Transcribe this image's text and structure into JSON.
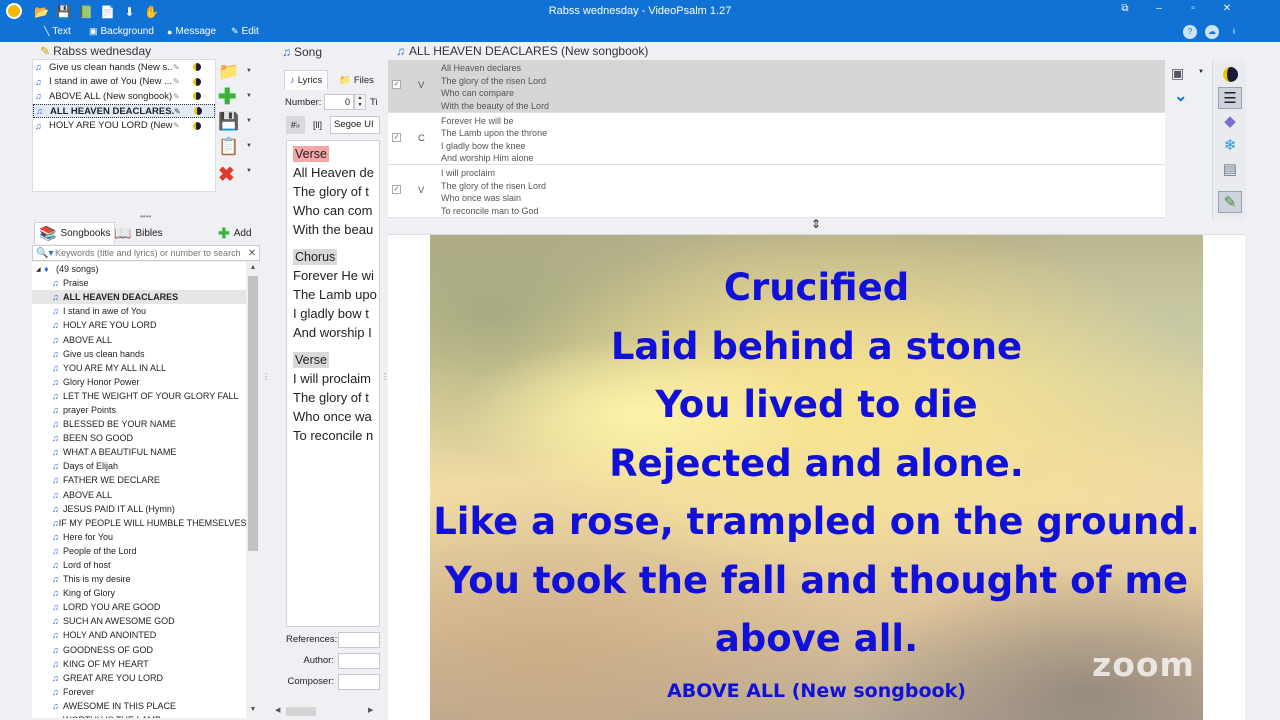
{
  "window": {
    "title": "Rabss wednesday - VideoPsalm 1.27",
    "minimize": "⧉",
    "restore": "–",
    "maximize": "▫",
    "close": "✕"
  },
  "menu": {
    "items": [
      {
        "label": "Text",
        "icon": "text-icon"
      },
      {
        "label": "Background",
        "icon": "background-icon"
      },
      {
        "label": "Message",
        "icon": "message-icon"
      },
      {
        "label": "Edit",
        "icon": "edit-icon"
      }
    ]
  },
  "schedule": {
    "title": "Rabss wednesday",
    "items": [
      {
        "label": "Give us clean hands (New s..."
      },
      {
        "label": "I stand in awe of You (New ..."
      },
      {
        "label": "ABOVE ALL (New songbook)"
      },
      {
        "label": "ALL HEAVEN DEACLARES..."
      },
      {
        "label": "HOLY ARE YOU LORD (New..."
      }
    ],
    "selected_index": 3
  },
  "songbook": {
    "tabs": {
      "songbooks": "Songbooks",
      "bibles": "Bibles",
      "add": "Add"
    },
    "search_placeholder": "Keywords (title and lyrics) or number to search",
    "root_label": "(49 songs)",
    "songs": [
      "Praise",
      "ALL HEAVEN DEACLARES",
      "I stand in awe of You",
      "HOLY ARE YOU LORD",
      "ABOVE ALL",
      "Give us clean hands",
      "YOU ARE MY ALL IN ALL",
      "Glory Honor Power",
      "LET THE WEIGHT OF YOUR GLORY FALL",
      "prayer Points",
      "BLESSED BE YOUR NAME",
      "BEEN SO GOOD",
      "WHAT A BEAUTIFUL NAME",
      "Days of Elijah",
      "FATHER WE DECLARE",
      "ABOVE ALL",
      "JESUS PAID IT ALL (Hymn)",
      "IF MY PEOPLE WILL HUMBLE THEMSELVES",
      "Here for You",
      "People of the Lord",
      "Lord of host",
      "This is my desire",
      "King of Glory",
      "LORD YOU ARE GOOD",
      "SUCH AN AWESOME GOD",
      "HOLY AND ANOINTED",
      "GOODNESS OF GOD",
      "KING OF MY HEART",
      "GREAT ARE YOU LORD",
      "Forever",
      "AWESOME IN THIS PLACE",
      "WORTHY IS THE LAMB"
    ],
    "selected_index": 1
  },
  "song_editor": {
    "title": "Song",
    "tabs": {
      "lyrics": "Lyrics",
      "files": "Files"
    },
    "number_label": "Number:",
    "number_value": "0",
    "title_label_cut": "Ti",
    "font_value": "Segoe UI",
    "blocks": [
      {
        "tag": "Verse",
        "lines": [
          "All Heaven de",
          "The glory of t",
          "Who can com",
          "With the beau"
        ]
      },
      {
        "tag": "Chorus",
        "lines": [
          "Forever He wi",
          "The Lamb upo",
          "I gladly bow t",
          "And worship I"
        ]
      },
      {
        "tag": "Verse",
        "lines": [
          "I will proclaim",
          "The glory of t",
          "Who once wa",
          "To reconcile n"
        ]
      }
    ],
    "references_label": "References:",
    "author_label": "Author:",
    "composer_label": "Composer:"
  },
  "verse_grid": {
    "title": "ALL HEAVEN DEACLARES (New songbook)",
    "rows": [
      {
        "code": "V",
        "check": "✓",
        "lines": [
          "All Heaven declares",
          "The glory of the risen Lord",
          "Who can compare",
          "With the beauty of the Lord"
        ]
      },
      {
        "code": "C",
        "check": "✓",
        "lines": [
          "Forever He will be",
          "The Lamb upon the throne",
          "I gladly bow the knee",
          "And worship Him alone"
        ]
      },
      {
        "code": "V",
        "check": "✓",
        "lines": [
          "I will proclaim",
          "The glory of the risen Lord",
          "Who once was slain",
          "To reconcile man to God"
        ]
      }
    ],
    "selected_index": 0
  },
  "slide": {
    "lines": [
      "Crucified",
      "Laid behind a stone",
      "You lived to die",
      "Rejected and alone.",
      "Like a rose, trampled on the ground.",
      "You took the fall and thought of me",
      "above all."
    ],
    "footer": "ABOVE ALL (New songbook)",
    "watermark": "zoom"
  },
  "colors": {
    "accent": "#1172d6",
    "slide_text": "#1010d8",
    "verse_tag": "#f4a7a7"
  }
}
